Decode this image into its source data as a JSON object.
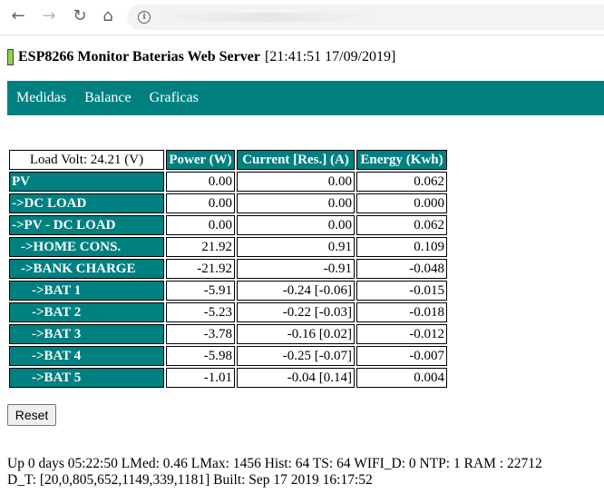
{
  "browser": {
    "back_glyph": "←",
    "forward_glyph": "→",
    "reload_glyph": "↻",
    "home_glyph": "⌂",
    "info_glyph": "i"
  },
  "header": {
    "title": "ESP8266 Monitor Baterias Web Server",
    "timestamp": "[21:41:51 17/09/2019]",
    "led_color": "#8fd14f"
  },
  "menu": {
    "items": [
      "Medidas",
      "Balance",
      "Graficas"
    ]
  },
  "table": {
    "load_volt": "Load Volt: 24.21 (V)",
    "headers": [
      "Power (W)",
      "Current [Res.] (A)",
      "Energy (Kwh)"
    ],
    "rows": [
      {
        "label": "PV",
        "power": "0.00",
        "current": "0.00",
        "energy": "0.062"
      },
      {
        "label": "->DC LOAD",
        "power": "0.00",
        "current": "0.00",
        "energy": "0.000"
      },
      {
        "label": "->PV - DC LOAD",
        "power": "0.00",
        "current": "0.00",
        "energy": "0.062"
      },
      {
        "label": "->HOME CONS.",
        "power": "21.92",
        "current": "0.91",
        "energy": "0.109"
      },
      {
        "label": "->BANK CHARGE",
        "power": "-21.92",
        "current": "-0.91",
        "energy": "-0.048"
      },
      {
        "label": "->BAT 1",
        "power": "-5.91",
        "current": "-0.24 [-0.06]",
        "energy": "-0.015"
      },
      {
        "label": "->BAT 2",
        "power": "-5.23",
        "current": "-0.22 [-0.03]",
        "energy": "-0.018"
      },
      {
        "label": "->BAT 3",
        "power": "-3.78",
        "current": "-0.16 [0.02]",
        "energy": "-0.012"
      },
      {
        "label": "->BAT 4",
        "power": "-5.98",
        "current": "-0.25 [-0.07]",
        "energy": "-0.007"
      },
      {
        "label": "->BAT 5",
        "power": "-1.01",
        "current": "-0.04 [0.14]",
        "energy": "0.004"
      }
    ]
  },
  "reset_label": "Reset",
  "status": {
    "line1": "Up 0 days 05:22:50 LMed: 0.46 LMax: 1456 Hist: 64 TS: 64 WIFI_D: 0 NTP: 1 RAM : 22712",
    "line2": "D_T: [20,0,805,652,1149,339,1181] Built: Sep 17 2019 16:17:52"
  },
  "colors": {
    "accent": "#008080"
  }
}
